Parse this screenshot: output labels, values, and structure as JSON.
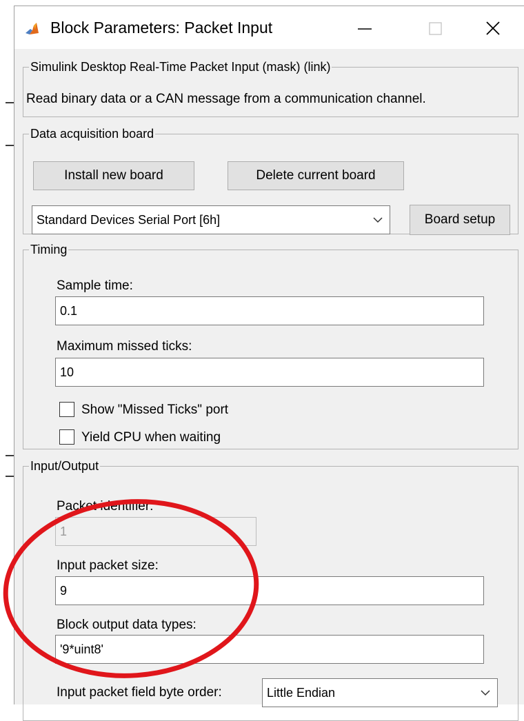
{
  "window": {
    "title": "Block Parameters: Packet Input",
    "icon": "matlab-icon",
    "controls": {
      "minimize": "minimize-icon",
      "maximize": "maximize-icon",
      "close": "close-icon"
    }
  },
  "description_group": {
    "legend": "Simulink Desktop Real-Time Packet Input (mask) (link)",
    "text": "Read binary data or a CAN message from a communication channel."
  },
  "board_group": {
    "legend": "Data acquisition board",
    "install_label": "Install new board",
    "delete_label": "Delete current board",
    "selected_board": "Standard Devices Serial Port [6h]",
    "setup_label": "Board setup"
  },
  "timing_group": {
    "legend": "Timing",
    "sample_time_label": "Sample time:",
    "sample_time_value": "0.1",
    "missed_ticks_label": "Maximum missed ticks:",
    "missed_ticks_value": "10",
    "show_missed_label": "Show \"Missed Ticks\" port",
    "show_missed_checked": false,
    "yield_cpu_label": "Yield CPU when waiting",
    "yield_cpu_checked": false
  },
  "io_group": {
    "legend": "Input/Output",
    "packet_id_label": "Packet identifier:",
    "packet_id_value": "1",
    "packet_size_label": "Input packet size:",
    "packet_size_value": "9",
    "output_types_label": "Block output data types:",
    "output_types_value": "'9*uint8'",
    "byte_order_label": "Input packet field byte order:",
    "byte_order_value": "Little Endian"
  },
  "annotation": {
    "color": "#e0161b",
    "shape": "ellipse"
  }
}
